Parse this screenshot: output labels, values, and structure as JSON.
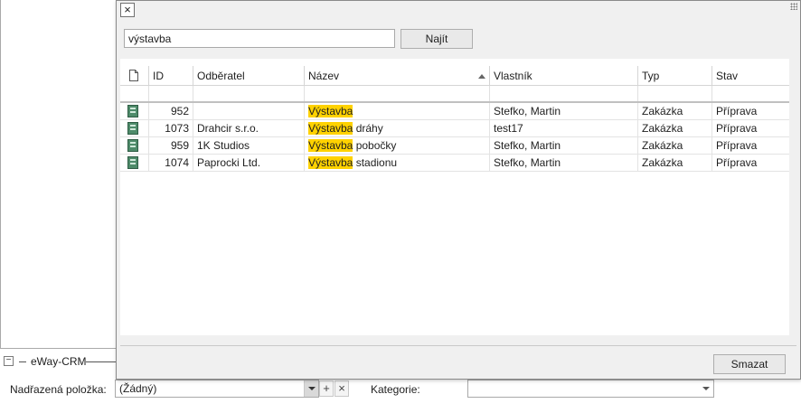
{
  "popup": {
    "search": {
      "value": "výstavba"
    },
    "find_label": "Najít",
    "delete_label": "Smazat",
    "columns": [
      "ID",
      "Odběratel",
      "Název",
      "Vlastník",
      "Typ",
      "Stav"
    ],
    "highlight_term": "Výstavba",
    "rows": [
      {
        "id": "952",
        "odberatel": "",
        "nazev_rest": "",
        "vlastnik": "Stefko, Martin",
        "typ": "Zakázka",
        "stav": "Příprava"
      },
      {
        "id": "1073",
        "odberatel": "Drahcir s.r.o.",
        "nazev_rest": " dráhy",
        "vlastnik": "test17",
        "typ": "Zakázka",
        "stav": "Příprava"
      },
      {
        "id": "959",
        "odberatel": "1K Studios",
        "nazev_rest": " pobočky",
        "vlastnik": "Stefko, Martin",
        "typ": "Zakázka",
        "stav": "Příprava"
      },
      {
        "id": "1074",
        "odberatel": "Paprocki Ltd.",
        "nazev_rest": " stadionu",
        "vlastnik": "Stefko, Martin",
        "typ": "Zakázka",
        "stav": "Příprava"
      }
    ]
  },
  "form": {
    "section_title": "eWay-CRM",
    "parent_label": "Nadřazená položka:",
    "parent_value": "(Žádný)",
    "category_label": "Kategorie:",
    "category_value": ""
  }
}
